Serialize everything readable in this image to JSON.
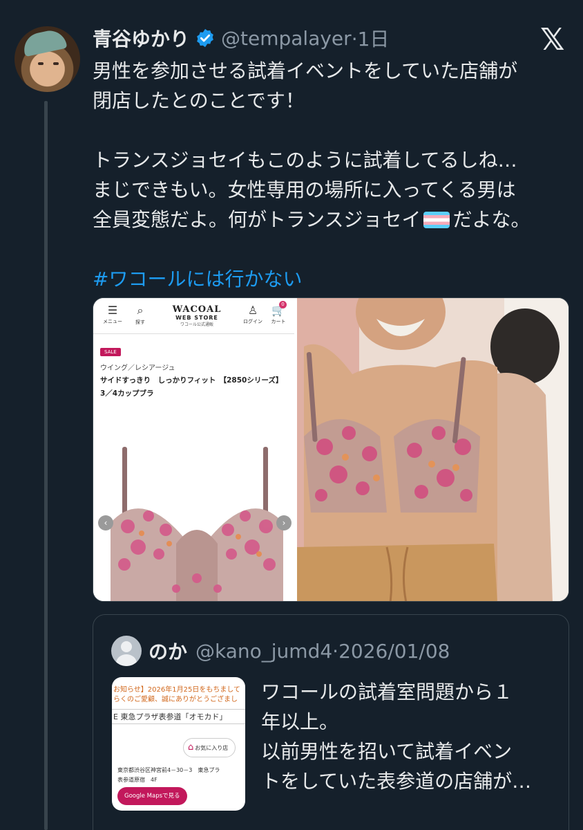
{
  "tweet": {
    "author_name": "青谷ゆかり",
    "author_handle": "@tempalayer",
    "time": "·1日",
    "text_part1": "男性を参加させる試着イベントをしていた店舗が\n閉店したとのことです！\n\nトランスジョセイもこのように試着してるしね…\nまじできもい。女性専用の場所に入ってくる男は\n全員変態だよ。何がトランスジョセイ",
    "text_part2": "だよな。",
    "hashtag": "#ワコールには行かない",
    "colors": {
      "background": "#15202b",
      "hashtag": "#1d9bf0",
      "verified": "#1d9bf0",
      "muted": "#8b98a5"
    }
  },
  "media_shop": {
    "menu_label": "メニュー",
    "search_label": "探す",
    "logo_line1": "WACOAL",
    "logo_line2": "WEB STORE",
    "logo_line3": "ワコール公式通販",
    "login_label": "ログイン",
    "cart_label": "カート",
    "cart_count": "0",
    "sale_badge": "SALE",
    "series": "ウイング／レシアージュ",
    "product_name": "サイドすっきり　しっかりフィット　【2850シリーズ】\n3／4カップブラ"
  },
  "quote": {
    "author_name": "のか",
    "author_handle": "@kano_jumd4",
    "date": "·2026/01/08",
    "text": "ワコールの試着室問題から１\n年以上。\n以前男性を招いて試着イベン\nトをしていた表参道の店舗が…",
    "thumb": {
      "notice": "お知らせ】2026年1月25日をもちまして\nらくのご愛顧、誠にありがとうござまし",
      "place": "E 東急プラザ表参道「オモカド」",
      "fav_label": "お気に入り店",
      "address": "東京都渋谷区神宮前4－30－3　東急プラ\n表参道原宿　4F",
      "maps_button": "Google Mapsで見る"
    }
  }
}
